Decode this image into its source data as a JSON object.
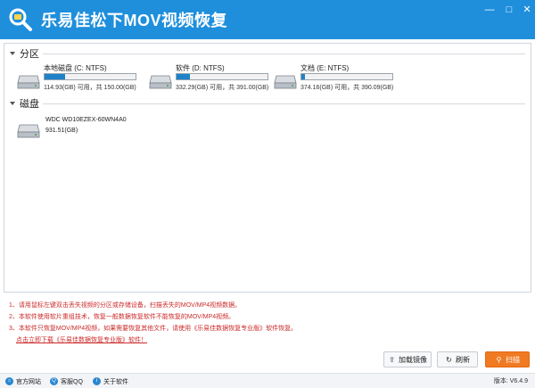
{
  "titlebar": {
    "title": "乐易佳松下MOV视频恢复",
    "minimize": "—",
    "maximize": "□",
    "close": "✕"
  },
  "sections": {
    "partitions_label": "分区",
    "disks_label": "磁盘"
  },
  "partitions": [
    {
      "name": "本地磁盘 (C: NTFS)",
      "size": "114.93(GB) 可用，共 150.00(GB)",
      "used_fraction": 0.23
    },
    {
      "name": "软件 (D: NTFS)",
      "size": "332.29(GB) 可用，共 391.00(GB)",
      "used_fraction": 0.15
    },
    {
      "name": "文档 (E: NTFS)",
      "size": "374.16(GB) 可用，共 390.09(GB)",
      "used_fraction": 0.04
    }
  ],
  "disks": [
    {
      "name": "WDC WD10EZEX-60WN4A0",
      "size": "931.51(GB)"
    }
  ],
  "notes": [
    "1、请用鼠标左键双击丢失视频的分区或存储设备，扫描丢失的MOV/MP4视频数据。",
    "2、本软件使用软片重组技术，恢复一般数据恢复软件不能恢复的MOV/MP4视频。",
    "3、本软件只恢复MOV/MP4视频，如果需要恢复其他文件，请使用《乐易佳数据恢复专业版》软件恢复。",
    "点击立即下载《乐易佳数据恢复专业版》软件！"
  ],
  "buttons": {
    "load_image": "加载镜像",
    "refresh": "刷新",
    "scan": "扫描"
  },
  "statusbar": {
    "website": "官方网站",
    "qq": "客服QQ",
    "about": "关于软件",
    "version": "版本: V6.4.9"
  },
  "colors": {
    "titlebar": "#1f8fdc",
    "progress_fill": "#1e82c8",
    "note_text": "#cc2a2a",
    "scan_button": "#f07a22"
  }
}
